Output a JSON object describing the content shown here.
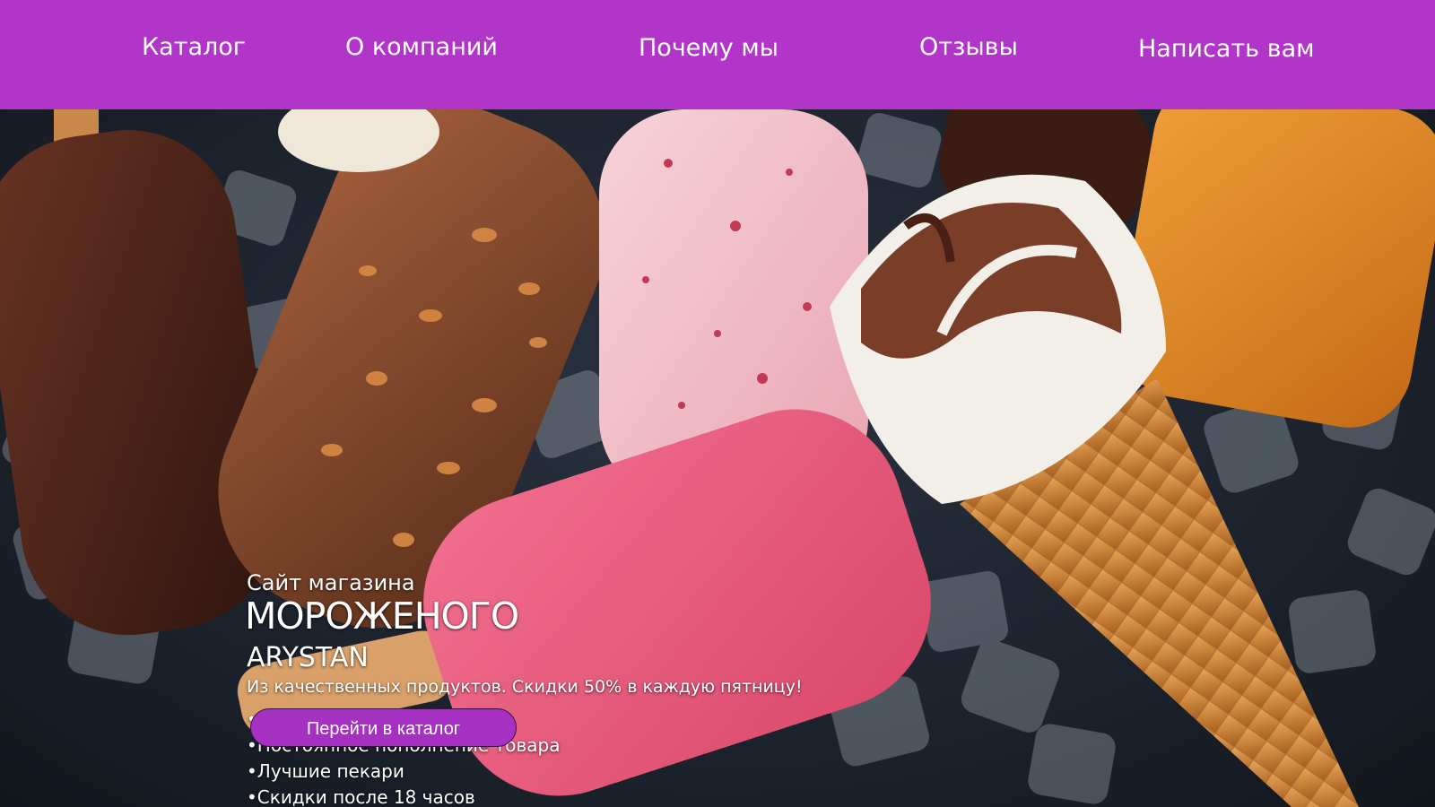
{
  "nav": {
    "items": [
      {
        "label": "Каталог"
      },
      {
        "label": "О компаний"
      },
      {
        "label": "Почему мы"
      },
      {
        "label": "Отзывы"
      },
      {
        "label": "Написать вам"
      }
    ]
  },
  "hero": {
    "pre_title": "Сайт магазина",
    "title": "МОРОЖЕНОГО",
    "brand": "ARYSTAN",
    "subtitle": "Из качественных продуктов. Скидки 50% в каждую пятницу!",
    "features": [
      "•Неповторимый вкус",
      "•Постоянное пополнение товара",
      "•Лучшие пекари",
      "•Скидки после 18 часов"
    ],
    "cta_label": "Перейти в каталог"
  },
  "colors": {
    "nav_background": "#b135c8",
    "button_background": "#a630c2",
    "text": "#ffffff"
  }
}
